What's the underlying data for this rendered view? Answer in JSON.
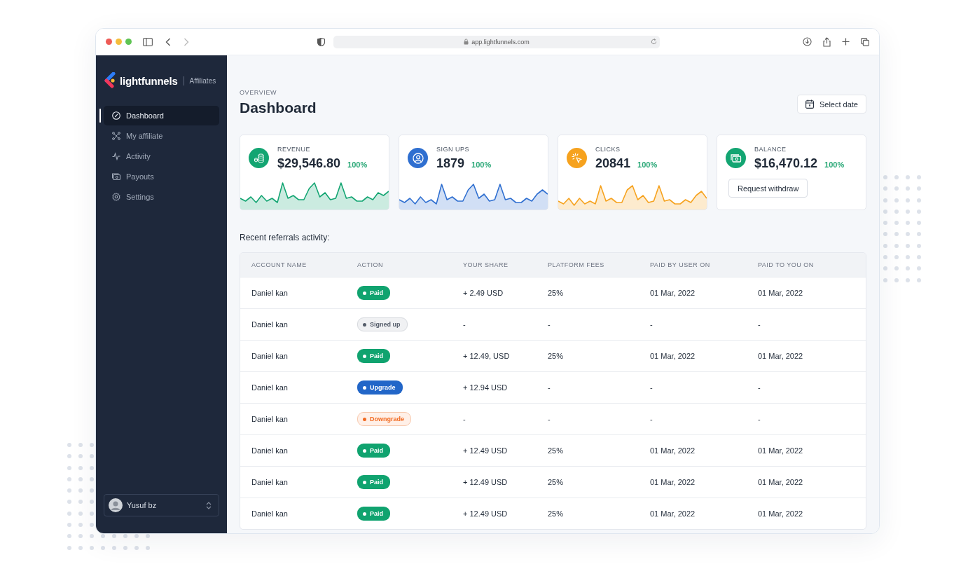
{
  "browser": {
    "url": "app.lightfunnels.com"
  },
  "sidebar": {
    "brand": "lightfunnels",
    "section": "Affiliates",
    "items": [
      {
        "label": "Dashboard",
        "selected": true
      },
      {
        "label": "My affiliate",
        "selected": false
      },
      {
        "label": "Activity",
        "selected": false
      },
      {
        "label": "Payouts",
        "selected": false
      },
      {
        "label": "Settings",
        "selected": false
      }
    ],
    "user": {
      "name": "Yusuf bz"
    }
  },
  "header": {
    "eyebrow": "OVERVIEW",
    "title": "Dashboard",
    "date_button": "Select date"
  },
  "stats": [
    {
      "label": "REVENUE",
      "value": "$29,546.80",
      "change": "100%",
      "color": "#13a572",
      "kind": "sparkline"
    },
    {
      "label": "SIGN UPS",
      "value": "1879",
      "change": "100%",
      "color": "#2f6fd0",
      "kind": "sparkline"
    },
    {
      "label": "CLICKS",
      "value": "20841",
      "change": "100%",
      "color": "#f6a21e",
      "kind": "sparkline"
    },
    {
      "label": "BALANCE",
      "value": "$16,470.12",
      "change": "100%",
      "color": "#13a572",
      "kind": "action",
      "button": "Request withdraw"
    }
  ],
  "table": {
    "title": "Recent referrals activity:",
    "columns": [
      "ACCOUNT NAME",
      "ACTION",
      "YOUR SHARE",
      "PLATFORM FEES",
      "PAID BY USER ON",
      "PAID TO YOU ON"
    ],
    "rows": [
      {
        "account": "Daniel kan",
        "action": {
          "label": "Paid",
          "kind": "paid"
        },
        "share": "+ 2.49 USD",
        "fees": "25%",
        "paid_by_user_on": "01 Mar, 2022",
        "paid_to_you_on": "01 Mar, 2022"
      },
      {
        "account": "Daniel kan",
        "action": {
          "label": "Signed up",
          "kind": "signed_up"
        },
        "share": "-",
        "fees": "-",
        "paid_by_user_on": "-",
        "paid_to_you_on": "-"
      },
      {
        "account": "Daniel kan",
        "action": {
          "label": "Paid",
          "kind": "paid"
        },
        "share": "+ 12.49, USD",
        "fees": "25%",
        "paid_by_user_on": "01 Mar, 2022",
        "paid_to_you_on": "01 Mar, 2022"
      },
      {
        "account": "Daniel kan",
        "action": {
          "label": "Upgrade",
          "kind": "upgrade"
        },
        "share": "+ 12.94 USD",
        "fees": "-",
        "paid_by_user_on": "-",
        "paid_to_you_on": "-"
      },
      {
        "account": "Daniel kan",
        "action": {
          "label": "Downgrade",
          "kind": "downgrade"
        },
        "share": "-",
        "fees": "-",
        "paid_by_user_on": "-",
        "paid_to_you_on": "-"
      },
      {
        "account": "Daniel kan",
        "action": {
          "label": "Paid",
          "kind": "paid"
        },
        "share": "+ 12.49 USD",
        "fees": "25%",
        "paid_by_user_on": "01 Mar, 2022",
        "paid_to_you_on": "01 Mar, 2022"
      },
      {
        "account": "Daniel kan",
        "action": {
          "label": "Paid",
          "kind": "paid"
        },
        "share": "+ 12.49 USD",
        "fees": "25%",
        "paid_by_user_on": "01 Mar, 2022",
        "paid_to_you_on": "01 Mar, 2022"
      },
      {
        "account": "Daniel kan",
        "action": {
          "label": "Paid",
          "kind": "paid"
        },
        "share": "+ 12.49 USD",
        "fees": "25%",
        "paid_by_user_on": "01 Mar, 2022",
        "paid_to_you_on": "01 Mar, 2022"
      }
    ]
  }
}
